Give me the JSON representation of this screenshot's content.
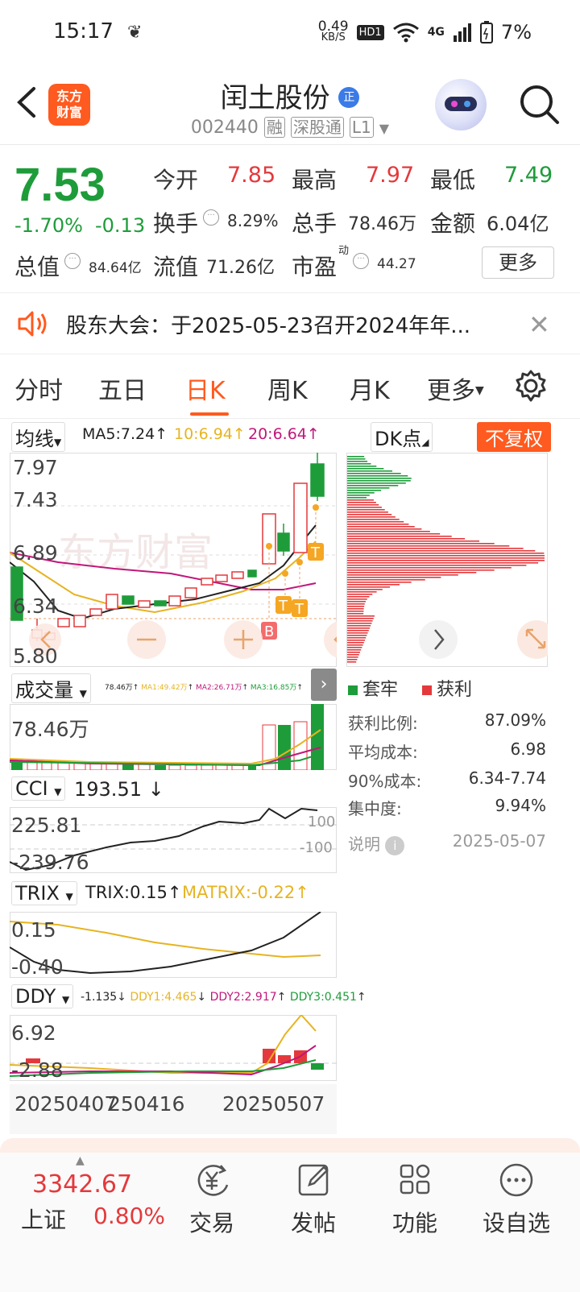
{
  "status": {
    "time": "15:17",
    "net_speed_top": "0.49",
    "net_speed_bottom": "KB/S",
    "hd": "HD1",
    "network": "4G",
    "battery": "7%"
  },
  "header": {
    "app_logo_line1": "东方",
    "app_logo_line2": "财富",
    "stock_name": "闰土股份",
    "name_badge": "正",
    "code": "002440",
    "tag_margin": "融",
    "tag_connect": "深股通",
    "tag_level": "L1"
  },
  "quote": {
    "price": "7.53",
    "change_pct": "-1.70%",
    "change_abs": "-0.13",
    "open_label": "今开",
    "open": "7.85",
    "high_label": "最高",
    "high": "7.97",
    "low_label": "最低",
    "low": "7.49",
    "turnover_label": "换手",
    "turnover": "8.29%",
    "volume_label": "总手",
    "volume": "78.46万",
    "amount_label": "金额",
    "amount": "6.04亿",
    "mcap_label": "总值",
    "mcap": "84.64亿",
    "float_label": "流值",
    "float": "71.26亿",
    "pe_label": "市盈",
    "pe_sup": "动",
    "pe": "44.27",
    "more": "更多"
  },
  "announcement": {
    "text": "股东大会：于2025-05-23召开2024年年..."
  },
  "tabs": {
    "t1": "分时",
    "t2": "五日",
    "t3": "日K",
    "t4": "周K",
    "t5": "月K",
    "t6": "更多"
  },
  "kline": {
    "ma_select": "均线",
    "ma5": "MA5:7.24",
    "ma10": "10:6.94",
    "ma20": "20:6.64",
    "axis": {
      "a1": "7.97",
      "a2": "7.43",
      "a3": "6.89",
      "a4": "6.34",
      "a5": "5.80"
    },
    "dk_select": "DK点",
    "fq_button": "不复权",
    "markers": {
      "b": "B",
      "t": "T"
    }
  },
  "volume": {
    "select": "成交量",
    "v": "78.46万",
    "ma1": "MA1:49.42万",
    "ma2": "MA2:26.71万",
    "ma3": "MA3:16.85万",
    "axis": "78.46万"
  },
  "cci": {
    "select": "CCI",
    "value": "193.51",
    "a1": "225.81",
    "a2": "-239.76",
    "ref_hi": "100",
    "ref_lo": "-100"
  },
  "trix": {
    "select": "TRIX",
    "trix": "TRIX:0.15",
    "matrix": "MATRIX:-0.22",
    "a1": "0.15",
    "a2": "-0.40"
  },
  "ddy": {
    "select": "DDY",
    "ddy": "-1.135",
    "ddy1": "DDY1:4.465",
    "ddy2": "DDY2:2.917",
    "ddy3": "DDY3:0.451",
    "a1": "6.92",
    "a2": "-2.88"
  },
  "dates": {
    "d1": "20250407",
    "d2": "250416",
    "d3": "20250507"
  },
  "chip": {
    "legend_trapped": "套牢",
    "legend_profit": "获利",
    "profit_ratio_label": "获利比例:",
    "profit_ratio": "87.09%",
    "avg_cost_label": "平均成本:",
    "avg_cost": "6.98",
    "cost90_label": "90%成本:",
    "cost90": "6.34-7.74",
    "concentration_label": "集中度:",
    "concentration": "9.94%",
    "note_label": "说明",
    "date": "2025-05-07"
  },
  "bottom": {
    "index_value": "3342.67",
    "index_name": "上证",
    "index_pct": "0.80%",
    "trade": "交易",
    "post": "发帖",
    "function": "功能",
    "watchlist": "设自选"
  },
  "colors": {
    "up": "#e4393c",
    "down": "#1e9c3a",
    "accent": "#ff5a1f",
    "ma5": "#222222",
    "ma10": "#e6b422",
    "ma20": "#c0177a"
  }
}
